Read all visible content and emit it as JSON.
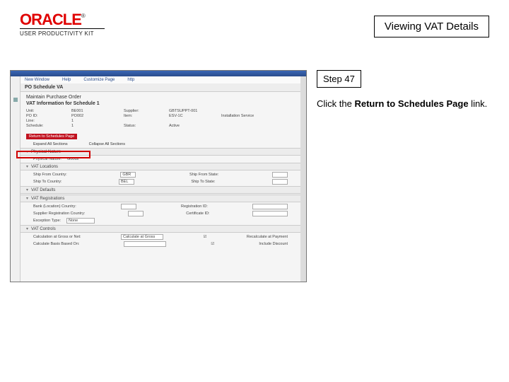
{
  "header": {
    "brand": "ORACLE",
    "tm": "®",
    "subbrand": "USER PRODUCTIVITY KIT",
    "title": "Viewing VAT Details"
  },
  "right": {
    "step": "Step 47",
    "instr_prefix": "Click the ",
    "instr_bold": "Return to Schedules Page",
    "instr_suffix": " link."
  },
  "shot": {
    "tabs": [
      "New Window",
      "Help",
      "Customize Page",
      "http"
    ],
    "crumb": "PO Schedule VA",
    "crumb_right": "",
    "p_title": "Maintain Purchase Order",
    "p_sub": "VAT Information for Schedule 1",
    "kv": {
      "unit_l": "Unit:",
      "unit_v": "BE001",
      "po_l": "PO ID:",
      "po_v": "PO002",
      "supplier_l": "Supplier:",
      "supplier_v": "GBTSUPPT-001",
      "item_l": "Item:",
      "item_v": "ESV-1C",
      "line_l": "Line:",
      "line_v": "1",
      "sched_l": "Schedule:",
      "sched_v": "1",
      "status_l": "Status:",
      "status_v": "Active",
      "instsrv": "Installation Service"
    },
    "return_link": "Return to Schedules Page",
    "expand": "Expand All Sections",
    "collapse": "Collapse All Sections",
    "sec_phys": "Physical Nature",
    "phys_label": "Physical Nature:",
    "phys_val": "Goods",
    "sec_vat_loc": "VAT Locations",
    "loc_from_l": "Ship From Country:",
    "loc_from_v": "GBR",
    "loc_to_l": "Ship To Country:",
    "loc_to_v": "BEL",
    "state_from_l": "Ship From State:",
    "state_to_l": "Ship To State:",
    "sec_def": "VAT Defaults",
    "sec_reg": "VAT Registrations",
    "bank_l": "Bank (Location) Country:",
    "bank_v": "",
    "supreg_l": "Supplier Registration Country:",
    "supreg_v": "",
    "regid_l": "Registration ID:",
    "cert_l": "Certificate ID:",
    "exc_l": "Exception Type:",
    "exc_v": "None",
    "sec_ctrl": "VAT Controls",
    "calc_l": "Calculation at Gross or Net:",
    "calc_v": "Calculate at Gross",
    "recalc_l": "Recalculate at Payment",
    "incl_l": "Include Discount",
    "basis_l": "Calculate Basis Based On:"
  }
}
